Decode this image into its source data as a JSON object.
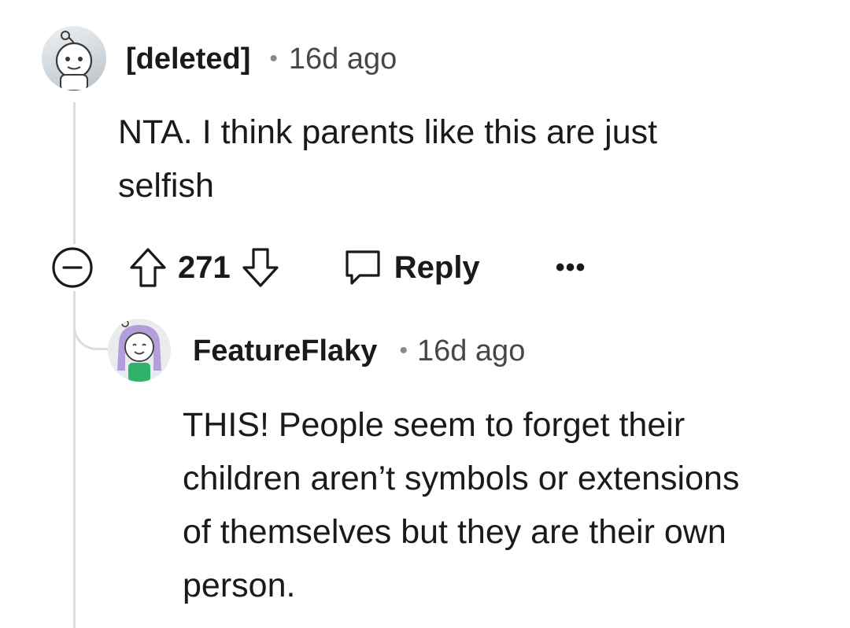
{
  "comments": [
    {
      "author": "[deleted]",
      "separator": "•",
      "time": "16d ago",
      "body_lines": [
        "NTA. I think parents like this are just",
        "selfish"
      ],
      "score": "271",
      "reply_label": "Reply",
      "more_label": "•••",
      "avatar_icon": "snoo-avatar-gray"
    },
    {
      "author": "FeatureFlaky",
      "separator": "•",
      "time": "16d ago",
      "body_lines": [
        "THIS! People seem to forget their",
        "children aren’t symbols or extensions",
        "of themselves but they are their own",
        "person."
      ],
      "avatar_icon": "snoo-avatar-purple-hair"
    }
  ],
  "colors": {
    "text": "#1a1a1b",
    "meta": "#454749",
    "thread_line": "#d9dde0",
    "avatar_accent": "#2fb36b",
    "avatar_hair": "#b39ddb"
  }
}
